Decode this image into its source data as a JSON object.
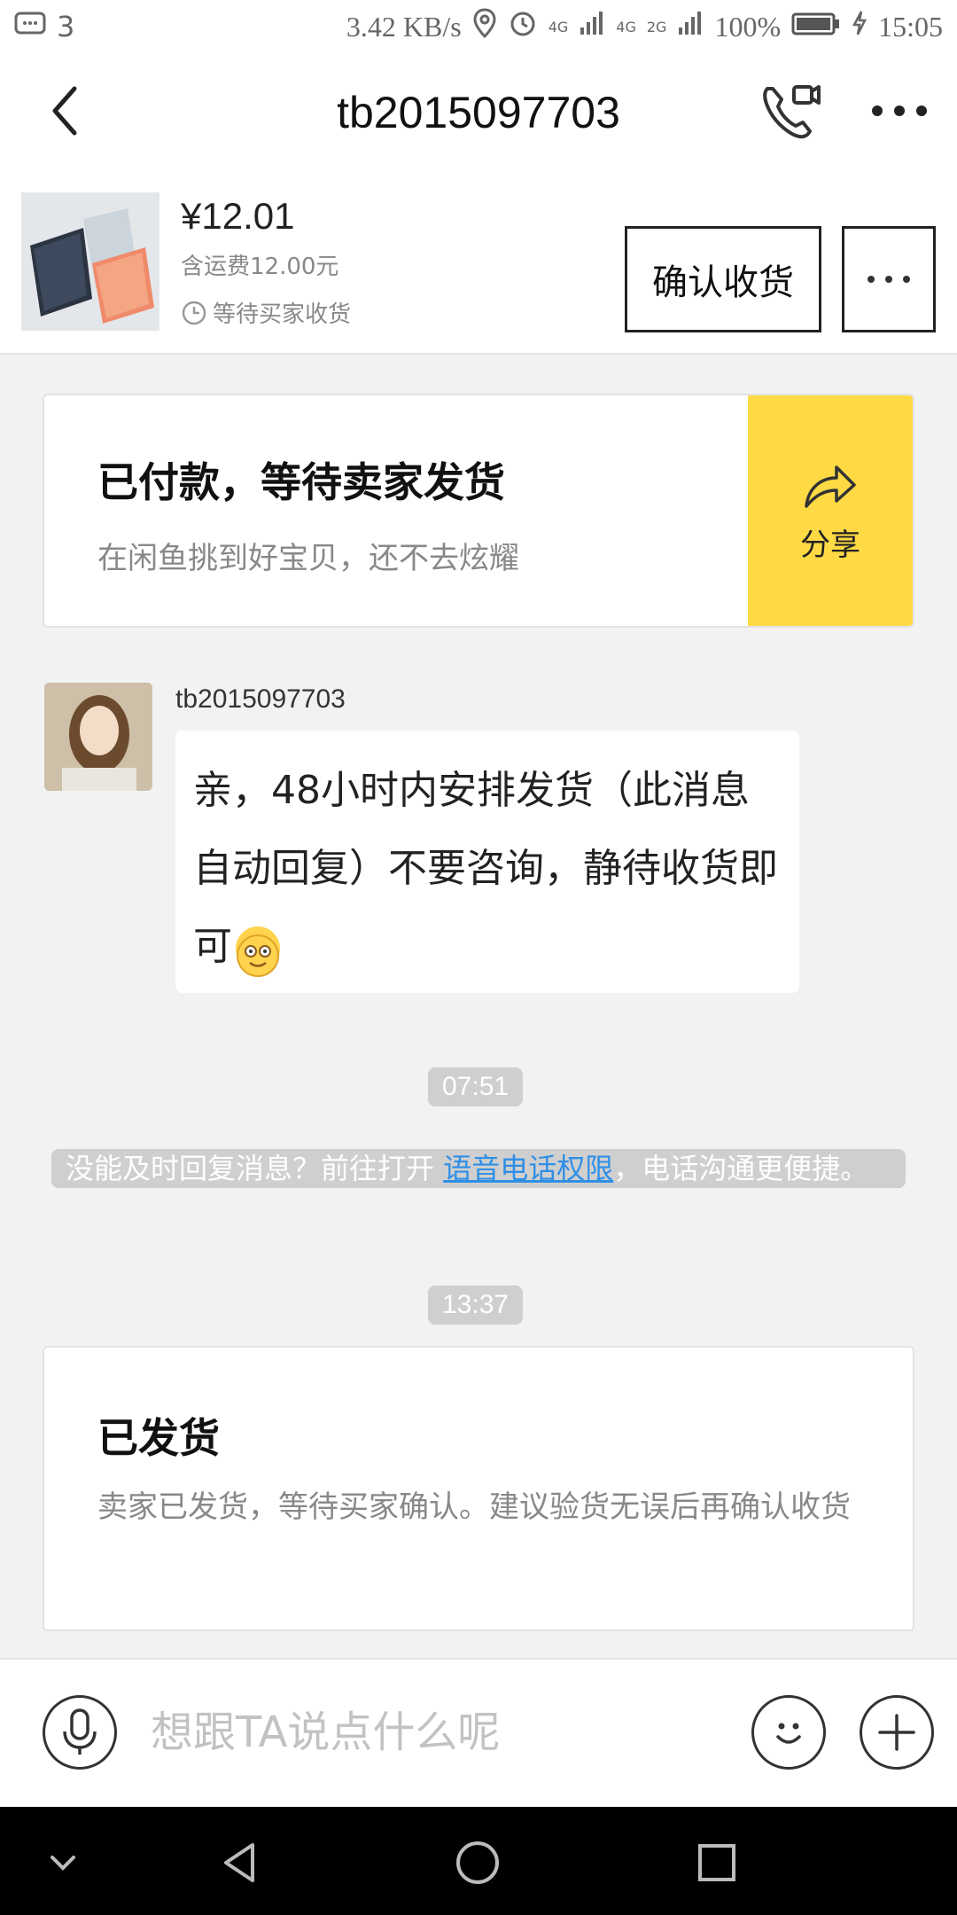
{
  "status_bar": {
    "notification_count": "3",
    "net_speed": "3.42 KB/s",
    "battery": "100%",
    "time": "15:05",
    "signal_1": "4G",
    "signal_2": "4G",
    "signal_3": "2G"
  },
  "header": {
    "title": "tb2015097703"
  },
  "product": {
    "price": "¥12.01",
    "shipping": "含运费12.00元",
    "status": "等待买家收货",
    "confirm_label": "确认收货"
  },
  "paid_card": {
    "title": "已付款，等待卖家发货",
    "subtitle": "在闲鱼挑到好宝贝，还不去炫耀",
    "share_label": "分享"
  },
  "message": {
    "sender": "tb2015097703",
    "text": "亲，48小时内安排发货（此消息自动回复）不要咨询，静待收货即可"
  },
  "timestamps": [
    "07:51",
    "13:37"
  ],
  "notice": {
    "before": "没能及时回复消息？前往打开 ",
    "link": "语音电话权限",
    "after": "，电话沟通更便捷。"
  },
  "shipped_card": {
    "title": "已发货",
    "description": "卖家已发货，等待买家确认。建议验货无误后再确认收货"
  },
  "input": {
    "placeholder": "想跟TA说点什么呢"
  },
  "colors": {
    "accent_yellow": "#ffda44",
    "link_blue": "#2f8fe6",
    "pill_gray": "#cfcfcf"
  }
}
